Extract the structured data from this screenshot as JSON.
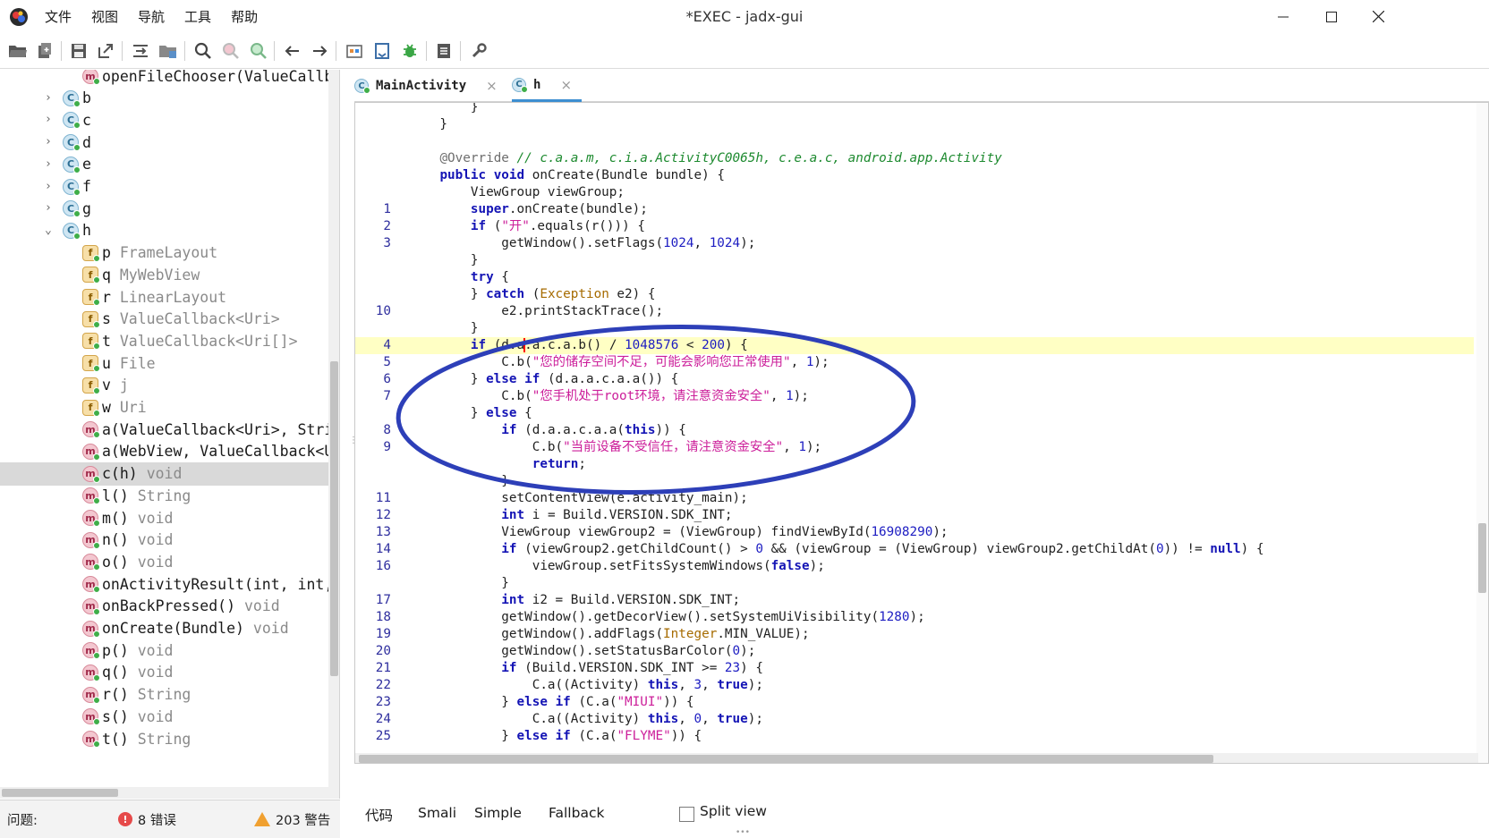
{
  "window": {
    "title": "*EXEC - jadx-gui",
    "menu": [
      "文件",
      "视图",
      "导航",
      "工具",
      "帮助"
    ],
    "controls": [
      "minimize",
      "maximize",
      "close"
    ]
  },
  "toolbar": {
    "icons": [
      "open-folder-icon",
      "add-file-icon",
      "save-icon",
      "export-icon",
      "sync-tree-icon",
      "flatten-packages-icon",
      "search-icon",
      "find-class-icon",
      "find-usage-icon",
      "back-icon",
      "forward-icon",
      "quark-icon",
      "decompile-all-icon",
      "debug-icon",
      "log-icon",
      "settings-icon"
    ]
  },
  "tree": {
    "rows": [
      {
        "kind": "method",
        "depth": 2,
        "name": "openFileChooser(ValueCallb",
        "type": "",
        "expander": "",
        "selected": false
      },
      {
        "kind": "class",
        "depth": 1,
        "name": "b",
        "type": "",
        "expander": "›",
        "selected": false
      },
      {
        "kind": "class",
        "depth": 1,
        "name": "c",
        "type": "",
        "expander": "›",
        "selected": false
      },
      {
        "kind": "class",
        "depth": 1,
        "name": "d",
        "type": "",
        "expander": "›",
        "selected": false
      },
      {
        "kind": "class",
        "depth": 1,
        "name": "e",
        "type": "",
        "expander": "›",
        "selected": false
      },
      {
        "kind": "class",
        "depth": 1,
        "name": "f",
        "type": "",
        "expander": "›",
        "selected": false
      },
      {
        "kind": "class",
        "depth": 1,
        "name": "g",
        "type": "",
        "expander": "›",
        "selected": false
      },
      {
        "kind": "class",
        "depth": 1,
        "name": "h",
        "type": "",
        "expander": "⌄",
        "selected": false
      },
      {
        "kind": "field",
        "depth": 2,
        "name": "p",
        "type": "FrameLayout",
        "expander": "",
        "selected": false
      },
      {
        "kind": "field",
        "depth": 2,
        "name": "q",
        "type": "MyWebView",
        "expander": "",
        "selected": false
      },
      {
        "kind": "field",
        "depth": 2,
        "name": "r",
        "type": "LinearLayout",
        "expander": "",
        "selected": false
      },
      {
        "kind": "field",
        "depth": 2,
        "name": "s",
        "type": "ValueCallback<Uri>",
        "expander": "",
        "selected": false
      },
      {
        "kind": "field",
        "depth": 2,
        "name": "t",
        "type": "ValueCallback<Uri[]>",
        "expander": "",
        "selected": false
      },
      {
        "kind": "field",
        "depth": 2,
        "name": "u",
        "type": "File",
        "expander": "",
        "selected": false
      },
      {
        "kind": "field",
        "depth": 2,
        "name": "v",
        "type": "j",
        "expander": "",
        "selected": false
      },
      {
        "kind": "field",
        "depth": 2,
        "name": "w",
        "type": "Uri",
        "expander": "",
        "selected": false
      },
      {
        "kind": "method",
        "depth": 2,
        "name": "a(ValueCallback<Uri>, Stri",
        "type": "",
        "expander": "",
        "selected": false
      },
      {
        "kind": "method",
        "depth": 2,
        "name": "a(WebView, ValueCallback<U",
        "type": "",
        "expander": "",
        "selected": false
      },
      {
        "kind": "method",
        "depth": 2,
        "name": "c(h)",
        "type": "void",
        "expander": "",
        "selected": true
      },
      {
        "kind": "method",
        "depth": 2,
        "name": "l()",
        "type": "String",
        "expander": "",
        "selected": false
      },
      {
        "kind": "method",
        "depth": 2,
        "name": "m()",
        "type": "void",
        "expander": "",
        "selected": false
      },
      {
        "kind": "method",
        "depth": 2,
        "name": "n()",
        "type": "void",
        "expander": "",
        "selected": false
      },
      {
        "kind": "method",
        "depth": 2,
        "name": "o()",
        "type": "void",
        "expander": "",
        "selected": false
      },
      {
        "kind": "method",
        "depth": 2,
        "name": "onActivityResult(int, int,",
        "type": "",
        "expander": "",
        "selected": false
      },
      {
        "kind": "method",
        "depth": 2,
        "name": "onBackPressed()",
        "type": "void",
        "expander": "",
        "selected": false
      },
      {
        "kind": "method",
        "depth": 2,
        "name": "onCreate(Bundle)",
        "type": "void",
        "expander": "",
        "selected": false
      },
      {
        "kind": "method",
        "depth": 2,
        "name": "p()",
        "type": "void",
        "expander": "",
        "selected": false
      },
      {
        "kind": "method",
        "depth": 2,
        "name": "q()",
        "type": "void",
        "expander": "",
        "selected": false
      },
      {
        "kind": "method",
        "depth": 2,
        "name": "r()",
        "type": "String",
        "expander": "",
        "selected": false
      },
      {
        "kind": "method",
        "depth": 2,
        "name": "s()",
        "type": "void",
        "expander": "",
        "selected": false
      },
      {
        "kind": "method",
        "depth": 2,
        "name": "t()",
        "type": "String",
        "expander": "",
        "selected": false
      }
    ]
  },
  "status": {
    "problems_label": "问题:",
    "errors": "8 错误",
    "warnings": "203 警告"
  },
  "tabs": [
    {
      "label": "MainActivity",
      "active": false
    },
    {
      "label": "h",
      "active": true
    }
  ],
  "code": {
    "lines": [
      {
        "n": "",
        "hl": false,
        "html": "        <span>}</span>"
      },
      {
        "n": "",
        "hl": false,
        "html": "    }"
      },
      {
        "n": "",
        "hl": false,
        "html": ""
      },
      {
        "n": "",
        "hl": false,
        "html": "    <span class='ann'>@Override</span> <span class='cmt'>// c.a.a.m, c.i.a.ActivityC0065h, c.e.a.c, android.app.Activity</span>"
      },
      {
        "n": "",
        "hl": false,
        "html": "    <span class='kw'>public</span> <span class='kw'>void</span> onCreate(Bundle bundle) {"
      },
      {
        "n": "",
        "hl": false,
        "html": "        ViewGroup viewGroup;"
      },
      {
        "n": "1",
        "hl": false,
        "html": "        <span class='kw'>super</span>.onCreate(bundle);"
      },
      {
        "n": "2",
        "hl": false,
        "html": "        <span class='kw'>if</span> (<span class='str'>\"开\"</span>.equals(r())) {"
      },
      {
        "n": "3",
        "hl": false,
        "html": "            getWindow().setFlags(<span class='num'>1024</span>, <span class='num'>1024</span>);"
      },
      {
        "n": "",
        "hl": false,
        "html": "        }"
      },
      {
        "n": "",
        "hl": false,
        "html": "        <span class='kw'>try</span> {"
      },
      {
        "n": "",
        "hl": false,
        "html": "        } <span class='kw'>catch</span> (<span class='typ'>Exception</span> e2) {"
      },
      {
        "n": "10",
        "hl": false,
        "html": "            e2.printStackTrace();"
      },
      {
        "n": "",
        "hl": false,
        "html": "        }"
      },
      {
        "n": "4",
        "hl": true,
        "html": "        <span class='kw'>if</span> (d.a<span class='caret'></span>.a.c.a.b() / <span class='num'>1048576</span> &lt; <span class='num'>200</span>) {"
      },
      {
        "n": "5",
        "hl": false,
        "html": "            C.b(<span class='str'>\"您的储存空间不足，可能会影响您正常使用\"</span>, <span class='num'>1</span>);"
      },
      {
        "n": "6",
        "hl": false,
        "html": "        } <span class='kw'>else</span> <span class='kw'>if</span> (d.a.a.c.a.a()) {"
      },
      {
        "n": "7",
        "hl": false,
        "html": "            C.b(<span class='str'>\"您手机处于root环境，请注意资金安全\"</span>, <span class='num'>1</span>);"
      },
      {
        "n": "",
        "hl": false,
        "html": "        } <span class='kw'>else</span> {"
      },
      {
        "n": "8",
        "hl": false,
        "html": "            <span class='kw'>if</span> (d.a.a.c.a.a(<span class='kw'>this</span>)) {"
      },
      {
        "n": "9",
        "hl": false,
        "html": "                C.b(<span class='str'>\"当前设备不受信任，请注意资金安全\"</span>, <span class='num'>1</span>);"
      },
      {
        "n": "",
        "hl": false,
        "html": "                <span class='kw'>return</span>;"
      },
      {
        "n": "",
        "hl": false,
        "html": "            }"
      },
      {
        "n": "11",
        "hl": false,
        "html": "            setContentView(e.activity_main);"
      },
      {
        "n": "12",
        "hl": false,
        "html": "            <span class='kw'>int</span> i = Build.VERSION.SDK_INT;"
      },
      {
        "n": "13",
        "hl": false,
        "html": "            ViewGroup viewGroup2 = (ViewGroup) findViewById(<span class='num'>16908290</span>);"
      },
      {
        "n": "14",
        "hl": false,
        "html": "            <span class='kw'>if</span> (viewGroup2.getChildCount() &gt; <span class='num'>0</span> &amp;&amp; (viewGroup = (ViewGroup) viewGroup2.getChildAt(<span class='num'>0</span>)) != <span class='kw'>null</span>) {"
      },
      {
        "n": "16",
        "hl": false,
        "html": "                viewGroup.setFitsSystemWindows(<span class='kw'>false</span>);"
      },
      {
        "n": "",
        "hl": false,
        "html": "            }"
      },
      {
        "n": "17",
        "hl": false,
        "html": "            <span class='kw'>int</span> i2 = Build.VERSION.SDK_INT;"
      },
      {
        "n": "18",
        "hl": false,
        "html": "            getWindow().getDecorView().setSystemUiVisibility(<span class='num'>1280</span>);"
      },
      {
        "n": "19",
        "hl": false,
        "html": "            getWindow().addFlags(<span class='typ'>Integer</span>.MIN_VALUE);"
      },
      {
        "n": "20",
        "hl": false,
        "html": "            getWindow().setStatusBarColor(<span class='num'>0</span>);"
      },
      {
        "n": "21",
        "hl": false,
        "html": "            <span class='kw'>if</span> (Build.VERSION.SDK_INT &gt;= <span class='num'>23</span>) {"
      },
      {
        "n": "22",
        "hl": false,
        "html": "                C.a((Activity) <span class='kw'>this</span>, <span class='num'>3</span>, <span class='kw'>true</span>);"
      },
      {
        "n": "23",
        "hl": false,
        "html": "            } <span class='kw'>else</span> <span class='kw'>if</span> (C.a(<span class='str'>\"MIUI\"</span>)) {"
      },
      {
        "n": "24",
        "hl": false,
        "html": "                C.a((Activity) <span class='kw'>this</span>, <span class='num'>0</span>, <span class='kw'>true</span>);"
      },
      {
        "n": "25",
        "hl": false,
        "html": "            } <span class='kw'>else</span> <span class='kw'>if</span> (C.a(<span class='str'>\"FLYME\"</span>)) {"
      }
    ]
  },
  "view_tabs": {
    "items": [
      "代码",
      "Smali",
      "Simple",
      "Fallback"
    ],
    "split_view_label": "Split view",
    "split_view_checked": false
  },
  "colors": {
    "keyword": "#1414b5",
    "string": "#cc1f9a",
    "comment": "#1d8a2f",
    "highlight_line": "#ffffc4",
    "annotation_ellipse": "#2d3fb8",
    "active_tab_accent": "#3d8fd1"
  }
}
